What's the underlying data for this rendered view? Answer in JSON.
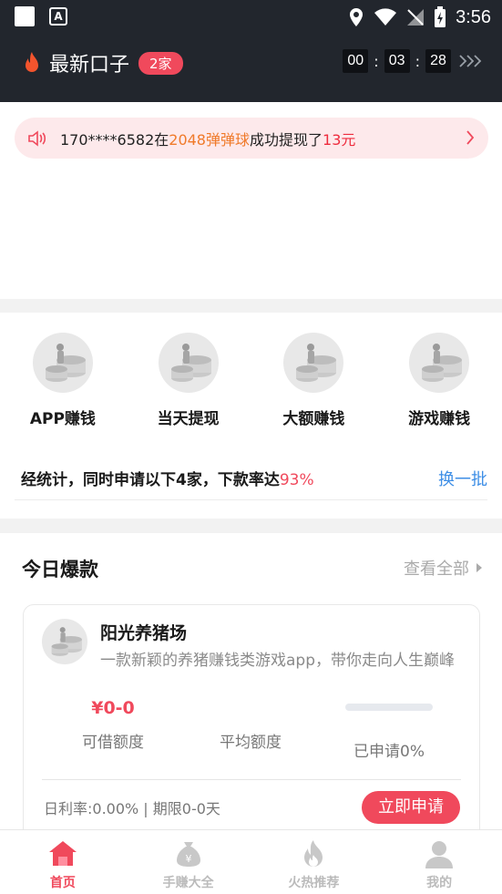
{
  "status_bar": {
    "time": "3:56"
  },
  "header": {
    "title": "最新口子",
    "badge": "2家",
    "timer": {
      "hours": "00",
      "minutes": "03",
      "seconds": "28"
    }
  },
  "notice": {
    "prefix": "170****6582在",
    "app_name": "2048弹弹球",
    "middle": "成功提现了",
    "amount": "13元"
  },
  "categories": [
    {
      "label": "APP赚钱",
      "icon": "coin-stack-icon"
    },
    {
      "label": "当天提现",
      "icon": "coin-stack-icon"
    },
    {
      "label": "大额赚钱",
      "icon": "coin-stack-icon"
    },
    {
      "label": "游戏赚钱",
      "icon": "coin-stack-icon"
    }
  ],
  "stats": {
    "text": "经统计，同时申请以下4家，下款率达",
    "percent": "93%",
    "refresh_label": "换一批"
  },
  "hot_today": {
    "title": "今日爆款",
    "view_all_label": "查看全部",
    "product": {
      "name": "阳光养猪场",
      "description": "一款新颖的养猪赚钱类游戏app，带你走向人生巅峰",
      "amount_value": "¥0-0",
      "amount_label": "可借额度",
      "average_label": "平均额度",
      "applied_fraction": 0,
      "applied_label": "已申请0%",
      "rate_text": "日利率:0.00% | 期限0-0天",
      "apply_label": "立即申请"
    }
  },
  "bottom_nav": [
    {
      "label": "首页",
      "icon": "home-icon",
      "active": true
    },
    {
      "label": "手赚大全",
      "icon": "money-bag-icon",
      "active": false
    },
    {
      "label": "火热推荐",
      "icon": "flame-icon",
      "active": false
    },
    {
      "label": "我的",
      "icon": "user-icon",
      "active": false
    }
  ],
  "colors": {
    "accent": "#f0495c",
    "header_bg": "#22262d",
    "link_blue": "#3d8ee6",
    "highlight_orange": "#f07a2a"
  }
}
